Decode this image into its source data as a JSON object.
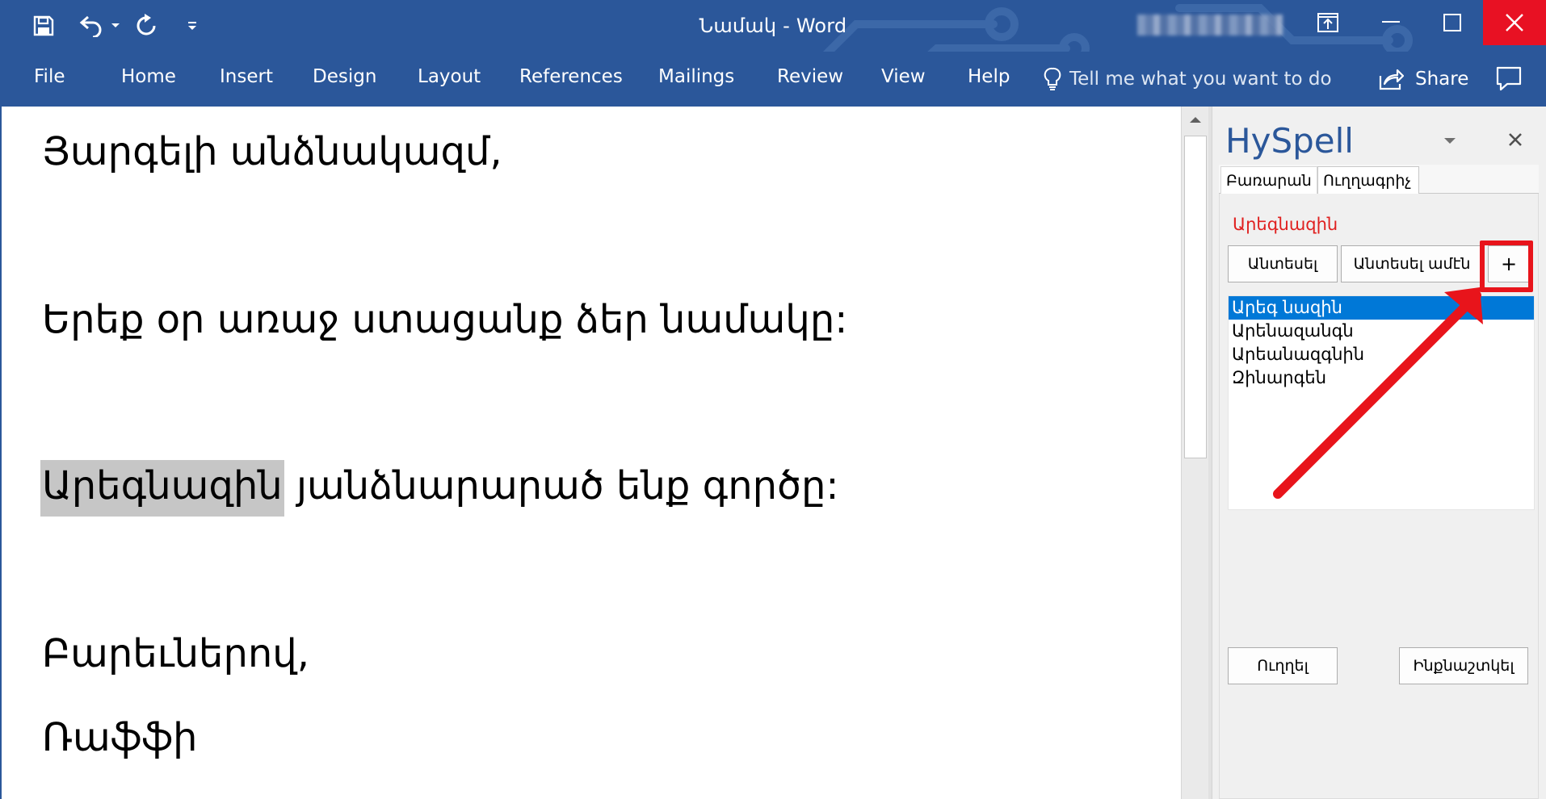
{
  "window": {
    "title": "Նամակ  -  Word",
    "controls": [
      "ribbon-display-options",
      "minimize",
      "maximize",
      "close"
    ]
  },
  "quick_access": {
    "icons": [
      "save-icon",
      "undo-icon",
      "undo-dropdown-icon",
      "redo-icon",
      "customize-qat-icon"
    ]
  },
  "ribbon": {
    "tabs": [
      {
        "label": "File"
      },
      {
        "label": "Home"
      },
      {
        "label": "Insert"
      },
      {
        "label": "Design"
      },
      {
        "label": "Layout"
      },
      {
        "label": "References"
      },
      {
        "label": "Mailings"
      },
      {
        "label": "Review"
      },
      {
        "label": "View"
      },
      {
        "label": "Help"
      }
    ],
    "tell_me": "Tell me what you want to do",
    "share": "Share"
  },
  "document": {
    "paragraphs": [
      {
        "text": "Յարգելի անձնակազմ,"
      },
      {
        "text": "Երեք օր առաջ ստացանք ձեր նամակը:"
      },
      {
        "highlighted": "Արեգնազին",
        "rest": " յանձնարարած ենք գործը:"
      },
      {
        "text": "Բարեւներով,"
      },
      {
        "text": "Ռաֆֆի"
      }
    ]
  },
  "pane": {
    "title": "HySpell",
    "tabs": [
      {
        "label": "Բառարան"
      },
      {
        "label": "Ուղղագրիչ"
      }
    ],
    "misspelled_word": "Արեգնազին",
    "buttons": {
      "ignore": "Անտեսել",
      "ignore_all": "Անտեսել ամէն",
      "add": "+",
      "correct": "Ուղղել",
      "autocorrect": "Ինքնաշտկել"
    },
    "suggestions": [
      {
        "text": "Արեգ նազին",
        "selected": true
      },
      {
        "text": "Արենազանգն",
        "selected": false
      },
      {
        "text": "Արեանազգնին",
        "selected": false
      },
      {
        "text": "Զինարգեն",
        "selected": false
      }
    ]
  },
  "colors": {
    "ribbon_blue": "#2b579a",
    "close_red": "#e81123",
    "selection_blue": "#0078d7",
    "misspelled_red": "#e0201f",
    "annotation_red": "#e8141b",
    "highlight_gray": "#c6c6c6"
  }
}
